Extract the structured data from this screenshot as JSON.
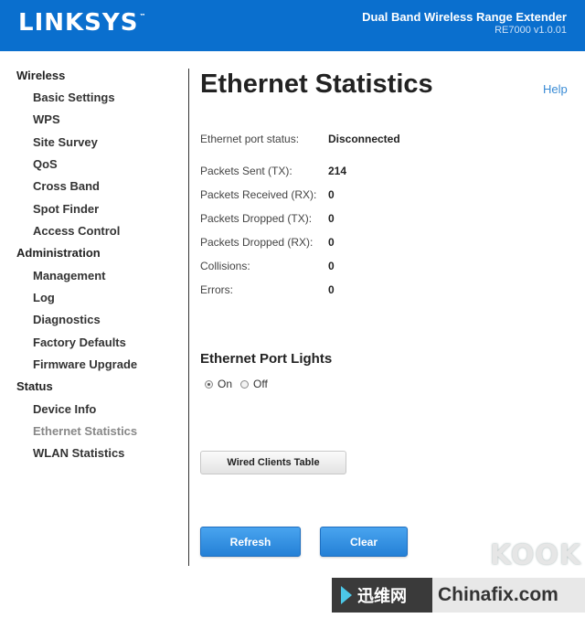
{
  "header": {
    "brand": "LINKSYS",
    "brand_tm": "™",
    "product": "Dual Band Wireless Range Extender",
    "model": "RE7000 v1.0.01"
  },
  "sidebar": {
    "items": [
      {
        "label": "Wireless",
        "level": "top"
      },
      {
        "label": "Basic Settings",
        "level": "sub"
      },
      {
        "label": "WPS",
        "level": "sub"
      },
      {
        "label": "Site Survey",
        "level": "sub"
      },
      {
        "label": "QoS",
        "level": "sub"
      },
      {
        "label": "Cross Band",
        "level": "sub"
      },
      {
        "label": "Spot Finder",
        "level": "sub"
      },
      {
        "label": "Access Control",
        "level": "sub"
      },
      {
        "label": "Administration",
        "level": "top"
      },
      {
        "label": "Management",
        "level": "sub"
      },
      {
        "label": "Log",
        "level": "sub"
      },
      {
        "label": "Diagnostics",
        "level": "sub"
      },
      {
        "label": "Factory Defaults",
        "level": "sub"
      },
      {
        "label": "Firmware Upgrade",
        "level": "sub"
      },
      {
        "label": "Status",
        "level": "top"
      },
      {
        "label": "Device Info",
        "level": "sub"
      },
      {
        "label": "Ethernet Statistics",
        "level": "sub",
        "active": true
      },
      {
        "label": "WLAN Statistics",
        "level": "sub"
      }
    ]
  },
  "main": {
    "title": "Ethernet Statistics",
    "help": "Help",
    "port_status_label": "Ethernet port status:",
    "port_status_value": "Disconnected",
    "stats": [
      {
        "label": "Packets Sent (TX):",
        "value": "214"
      },
      {
        "label": "Packets Received (RX):",
        "value": "0"
      },
      {
        "label": "Packets Dropped (TX):",
        "value": "0"
      },
      {
        "label": "Packets Dropped (RX):",
        "value": "0"
      },
      {
        "label": "Collisions:",
        "value": "0"
      },
      {
        "label": "Errors:",
        "value": "0"
      }
    ],
    "lights_title": "Ethernet Port Lights",
    "lights_on_label": "On",
    "lights_off_label": "Off",
    "lights_selected": "On",
    "wired_clients_button": "Wired Clients Table",
    "refresh_button": "Refresh",
    "clear_button": "Clear"
  },
  "watermark": {
    "kook": "KOOK",
    "cn_text": "迅维网",
    "site": "Chinafix.com"
  },
  "colors": {
    "header_bg": "#0a6fce",
    "link": "#3a8bd5",
    "primary_button": "#2f8ee0",
    "active_nav": "#888888"
  }
}
